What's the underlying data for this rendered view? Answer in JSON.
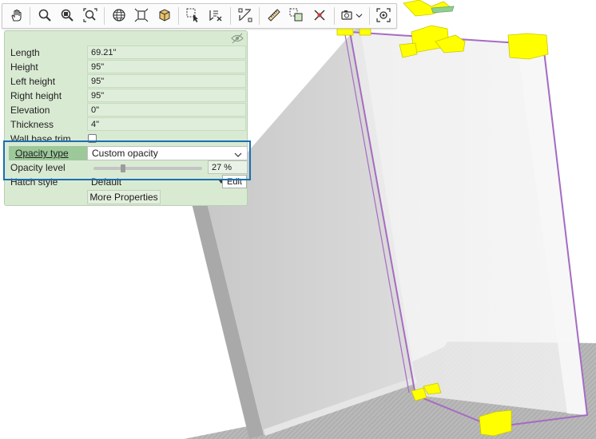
{
  "toolbar": {
    "buttons": [
      {
        "name": "pan-hand",
        "icon": "hand-icon"
      },
      {
        "name": "zoom",
        "icon": "magnifier-icon"
      },
      {
        "name": "zoom-window",
        "icon": "zoom-window-icon"
      },
      {
        "name": "zoom-extents",
        "icon": "zoom-extents-icon"
      },
      {
        "name": "orbit",
        "icon": "globe-icon"
      },
      {
        "name": "fit-selection",
        "icon": "fit-selection-icon"
      },
      {
        "name": "3d-box",
        "icon": "cube-view-icon"
      },
      {
        "name": "select-cursor",
        "icon": "select-cursor-icon"
      },
      {
        "name": "select-list",
        "icon": "select-list-icon"
      },
      {
        "name": "dimension",
        "icon": "dimension-icon"
      },
      {
        "name": "measure",
        "icon": "ruler-icon"
      },
      {
        "name": "copy-select",
        "icon": "copy-select-icon"
      },
      {
        "name": "delete",
        "icon": "delete-x-icon"
      },
      {
        "name": "camera",
        "icon": "camera-icon"
      },
      {
        "name": "focus",
        "icon": "focus-target-icon"
      }
    ]
  },
  "properties": {
    "length": {
      "label": "Length",
      "value": "69.21\""
    },
    "height": {
      "label": "Height",
      "value": "95\""
    },
    "left_height": {
      "label": "Left height",
      "value": "95\""
    },
    "right_height": {
      "label": "Right height",
      "value": "95\""
    },
    "elevation": {
      "label": "Elevation",
      "value": "0\""
    },
    "thickness": {
      "label": "Thickness",
      "value": "4\""
    },
    "wall_base_trim": {
      "label": "Wall base trim",
      "checked": false
    },
    "opacity_type": {
      "label": "Opacity type",
      "value": "Custom opacity"
    },
    "opacity_level": {
      "label": "Opacity level",
      "value": "27 %",
      "fraction": 0.27
    },
    "hatch_style": {
      "label": "Hatch style",
      "value": "Default",
      "edit_label": "Edit"
    },
    "more_properties": "More Properties"
  },
  "colors": {
    "panel_bg": "#d9ead3",
    "highlight_label": "#9cc89a",
    "callout": "#1a6fb2",
    "selection_outline": "#a56cc1",
    "grip_handles": "#ffff00"
  }
}
